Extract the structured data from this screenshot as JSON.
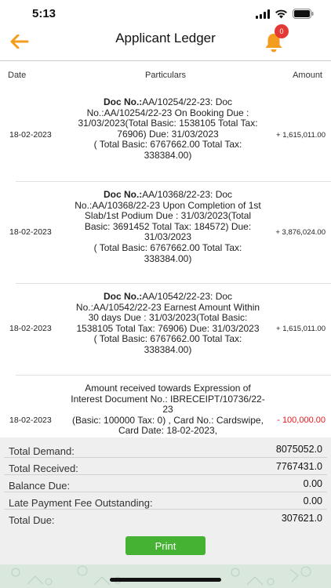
{
  "status_bar": {
    "time": "5:13"
  },
  "header": {
    "title": "Applicant Ledger",
    "notification_count": "0"
  },
  "columns": {
    "date": "Date",
    "particulars": "Particulars",
    "amount": "Amount"
  },
  "rows": [
    {
      "date": "18-02-2023",
      "doc_label": "Doc No.:",
      "particulars": "AA/10254/22-23: Doc No.:AA/10254/22-23  On Booking Due : 31/03/2023(Total Basic: 1538105 Total Tax: 76906) Due: 31/03/2023\n( Total Basic: 6767662.00 Total Tax: 338384.00)",
      "amount": "+ 1,615,011.00"
    },
    {
      "date": "18-02-2023",
      "doc_label": "Doc No.:",
      "particulars": "AA/10368/22-23: Doc No.:AA/10368/22-23  Upon Completion of 1st Slab/1st Podium Due : 31/03/2023(Total Basic: 3691452 Total Tax: 184572) Due: 31/03/2023\n( Total Basic: 6767662.00 Total Tax: 338384.00)",
      "amount": "+ 3,876,024.00"
    },
    {
      "date": "18-02-2023",
      "doc_label": "Doc No.:",
      "particulars": "AA/10542/22-23: Doc No.:AA/10542/22-23  Earnest Amount Within 30 days Due : 31/03/2023(Total Basic: 1538105 Total Tax: 76906) Due: 31/03/2023\n( Total Basic: 6767662.00 Total Tax: 338384.00)",
      "amount": "+ 1,615,011.00"
    },
    {
      "date": "18-02-2023",
      "doc_label": "",
      "particulars": "Amount received towards Expression of Interest Document No.: IBRECEIPT/10736/22-23\n(Basic: 100000 Tax: 0) , Card No.: Cardswipe, Card Date: 18-02-2023,",
      "amount": "- 100,000.00"
    }
  ],
  "summary": {
    "total_demand_label": "Total Demand:",
    "total_demand": "8075052.0",
    "total_received_label": "Total Received:",
    "total_received": "7767431.0",
    "balance_due_label": "Balance Due:",
    "balance_due": "0.00",
    "late_fee_label": "Late Payment Fee Outstanding:",
    "late_fee": "0.00",
    "total_due_label": "Total Due:",
    "total_due": "307621.0"
  },
  "print_label": "Print",
  "colors": {
    "accent": "#f39c1f",
    "badge": "#e53935",
    "negative": "#e41b1b",
    "print": "#45b233"
  }
}
